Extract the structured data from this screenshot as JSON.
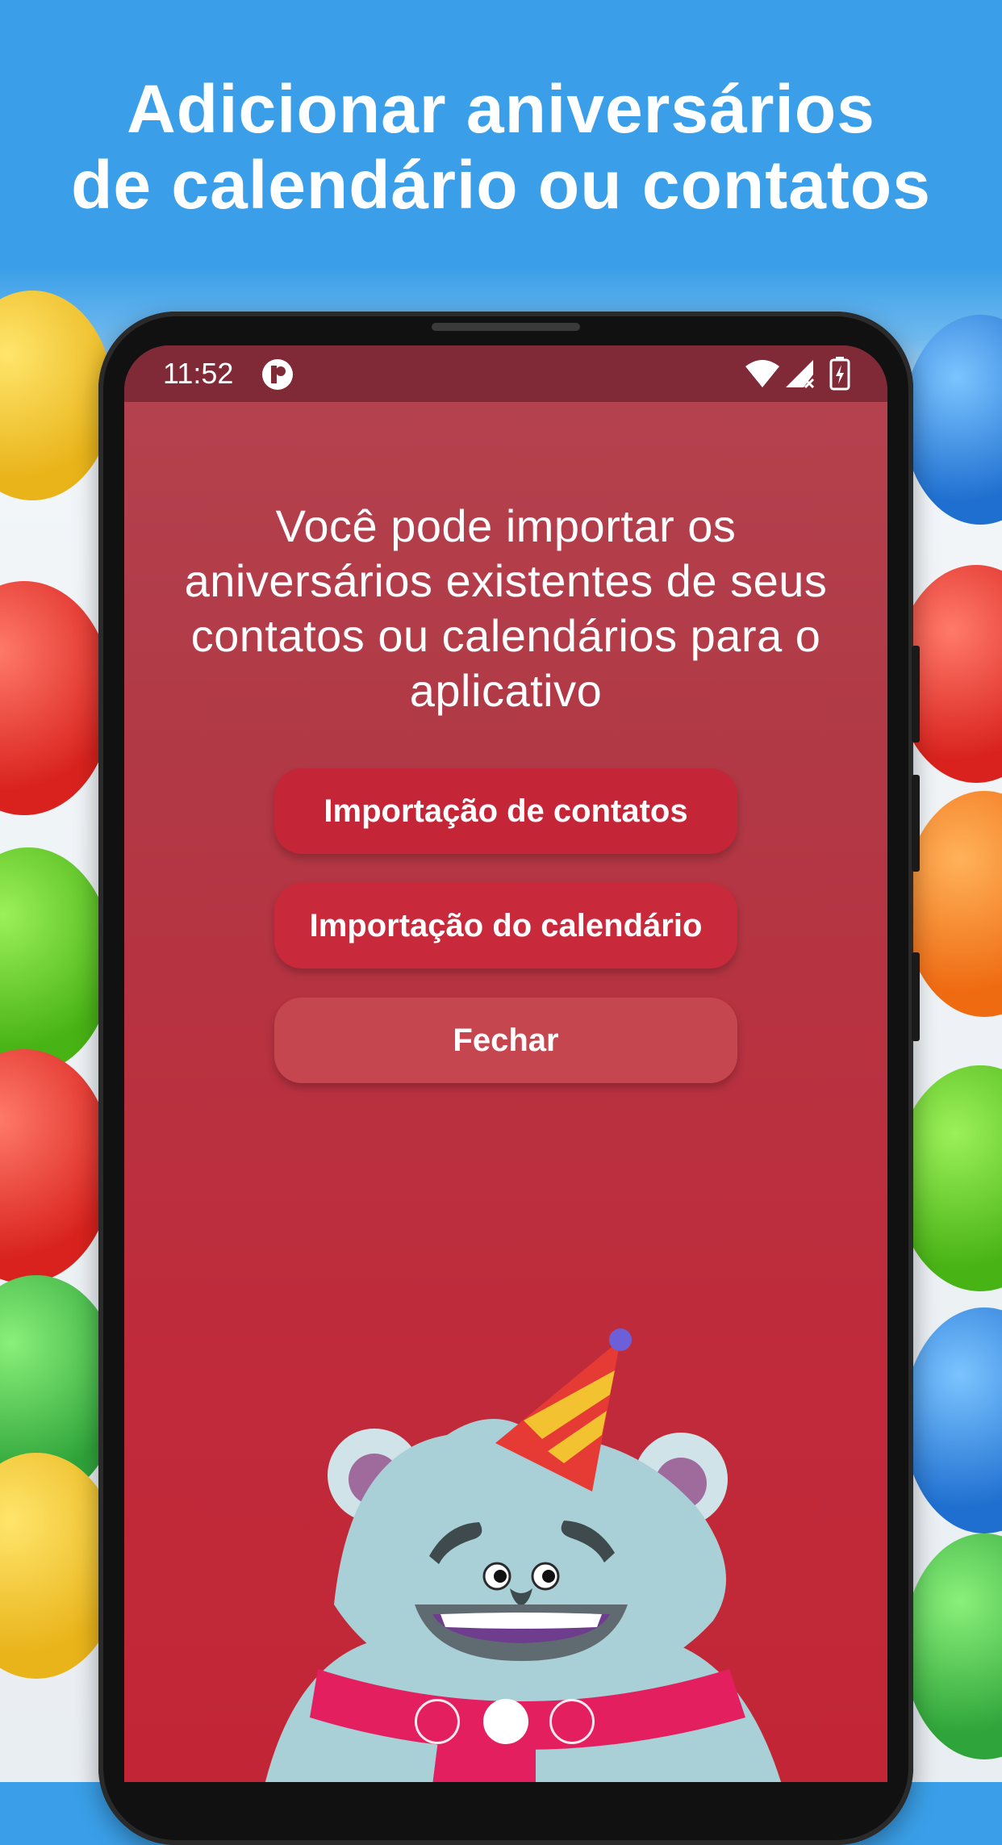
{
  "headline": {
    "line1": "Adicionar aniversários",
    "line2": "de calendário ou contatos"
  },
  "statusbar": {
    "time": "11:52",
    "icons": [
      "app-notification-icon",
      "wifi-icon",
      "signal-icon",
      "battery-charging-icon"
    ]
  },
  "screen": {
    "message": "Você pode importar os aniversários existentes de seus contatos ou calendários para o aplicativo",
    "buttons": {
      "contacts": "Importação de contatos",
      "calendar": "Importação do calendário",
      "close": "Fechar"
    },
    "pager": {
      "total": 3,
      "active": 2
    }
  },
  "colors": {
    "headline_bg": "#3a9fe8",
    "screen_bg": "#c02a3a",
    "statusbar_bg": "#7f2a36",
    "button_primary": "#c42638",
    "button_close": "#c6464f"
  }
}
